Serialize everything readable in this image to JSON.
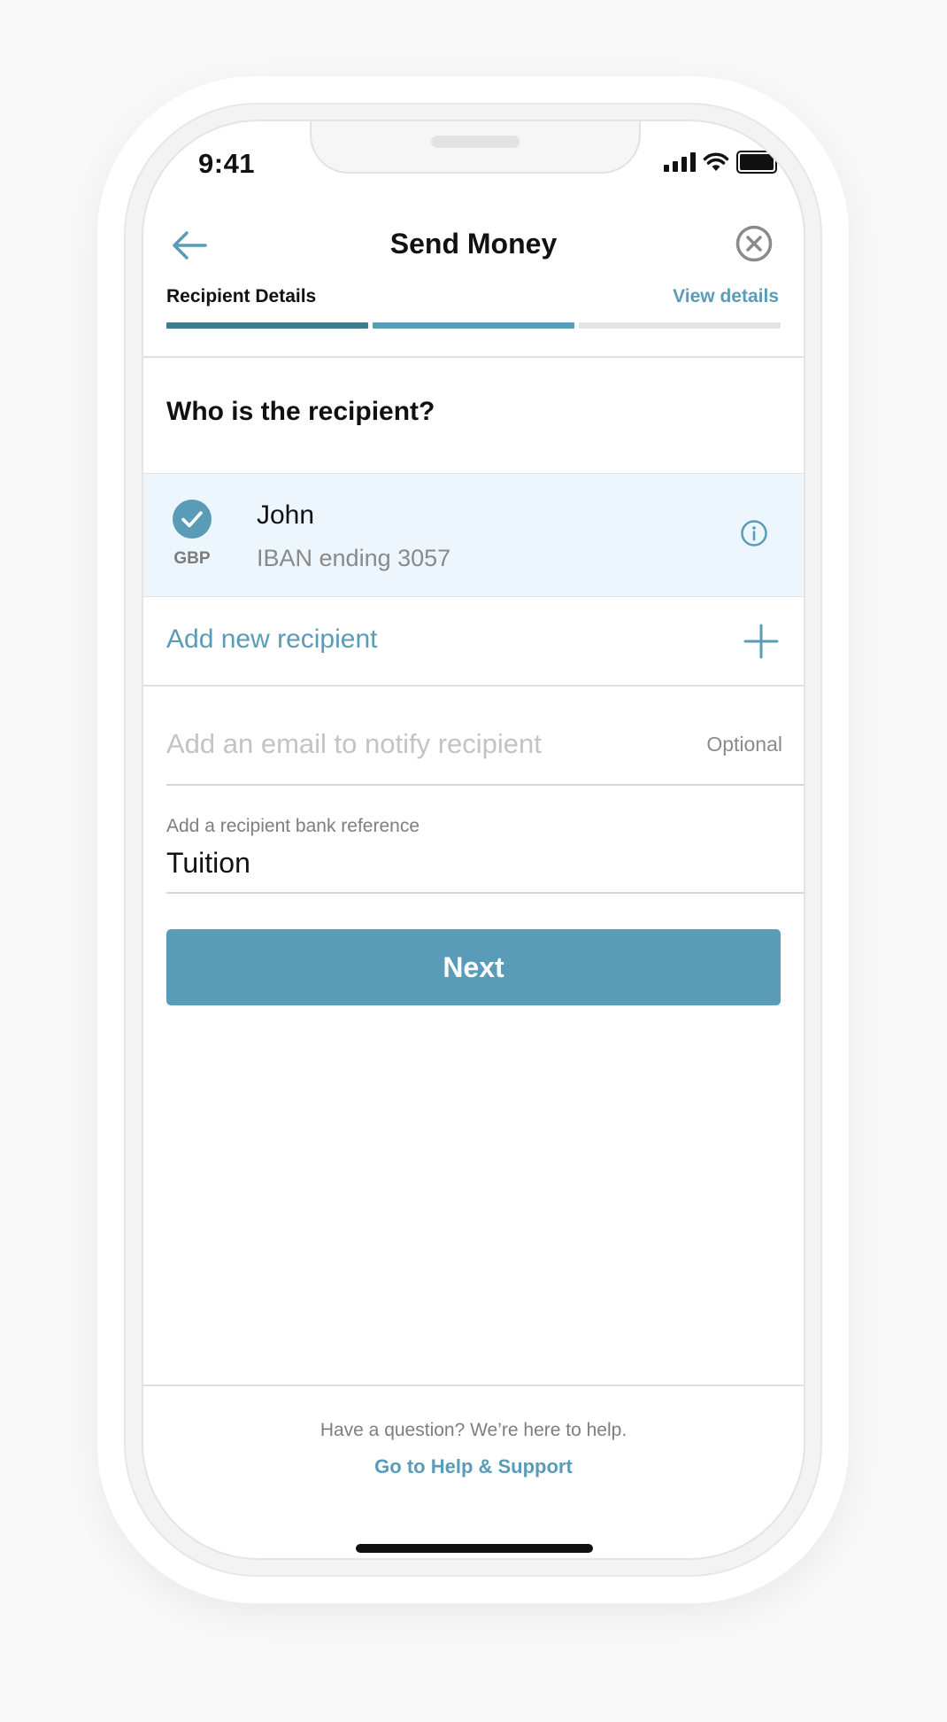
{
  "status_bar": {
    "time": "9:41"
  },
  "header": {
    "title": "Send Money"
  },
  "steps": {
    "current_label": "Recipient Details",
    "view_details_label": "View details",
    "progress": [
      {
        "state": "complete",
        "color": "#3f7a90"
      },
      {
        "state": "active",
        "color": "#5a9bb8"
      },
      {
        "state": "pending",
        "color": "#e4e4e4"
      }
    ]
  },
  "question": "Who is the recipient?",
  "selected_recipient": {
    "name": "John",
    "currency": "GBP",
    "account": "IBAN ending 3057",
    "selected": true
  },
  "add_new_recipient": {
    "label": "Add new recipient"
  },
  "email_field": {
    "value": "",
    "placeholder": "Add an email to notify recipient",
    "hint": "Optional"
  },
  "reference_field": {
    "label": "Add a recipient bank reference",
    "value": "Tuition"
  },
  "next_button": {
    "label": "Next"
  },
  "footer": {
    "help_text": "Have a question? We’re here to help.",
    "help_link": "Go to Help & Support"
  },
  "colors": {
    "accent": "#5a9bb8",
    "accent_dark": "#3f7a90",
    "selected_row": "#edf5fd"
  },
  "icons": {
    "back": "arrow-left-icon",
    "close": "close-circle-icon",
    "check": "checkmark-icon",
    "info": "info-icon",
    "add": "plus-icon"
  }
}
